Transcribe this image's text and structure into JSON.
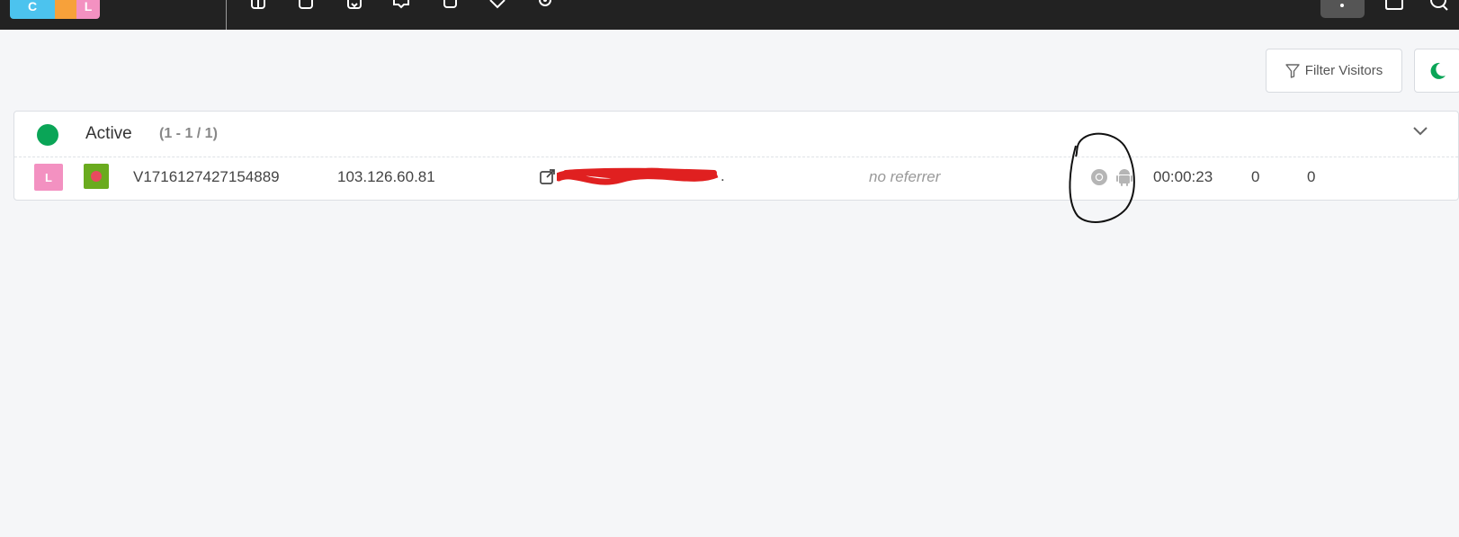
{
  "header": {
    "logo_letters": [
      "C",
      "",
      "L"
    ],
    "nav_icons": [
      "dashboard-icon",
      "chat-icon",
      "history-icon",
      "reports-icon",
      "copy-icon",
      "tag-icon",
      "settings-icon"
    ],
    "right_icons": [
      "chat-icon",
      "search-icon"
    ]
  },
  "toolbar": {
    "filter_label": "Filter Visitors",
    "theme_icon": "moon-icon"
  },
  "section": {
    "label": "Active",
    "count": "(1 - 1 / 1)"
  },
  "visitor": {
    "avatar_letter": "L",
    "id": "V1716127427154889",
    "ip": "103.126.60.81",
    "page_suffix": ".",
    "referrer": "no referrer",
    "browser_icon": "chrome-icon",
    "os_icon": "android-icon",
    "duration": "00:00:23",
    "metric_a": "0",
    "metric_b": "0"
  },
  "colors": {
    "active": "#0aa557",
    "topbar": "#222222",
    "avatar": "#f391c1",
    "recording": "#6aab1e",
    "redaction": "#e02020"
  }
}
